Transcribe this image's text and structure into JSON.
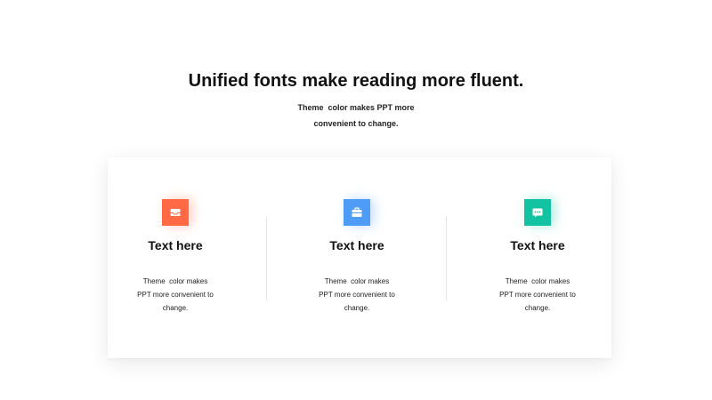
{
  "slide": {
    "title": "Unified fonts make reading more fluent.",
    "subtitle": "Theme  color makes PPT more\nconvenient to change."
  },
  "columns": [
    {
      "icon": "inbox-icon",
      "color": "#ff6a45",
      "heading": "Text here",
      "text": "Theme  color makes\nPPT more convenient to\nchange."
    },
    {
      "icon": "briefcase-icon",
      "color": "#4f9cf7",
      "heading": "Text here",
      "text": "Theme  color makes\nPPT more convenient to\nchange."
    },
    {
      "icon": "chat-bubble-icon",
      "color": "#12c2a0",
      "heading": "Text here",
      "text": "Theme  color makes\nPPT more convenient to\nchange."
    }
  ]
}
